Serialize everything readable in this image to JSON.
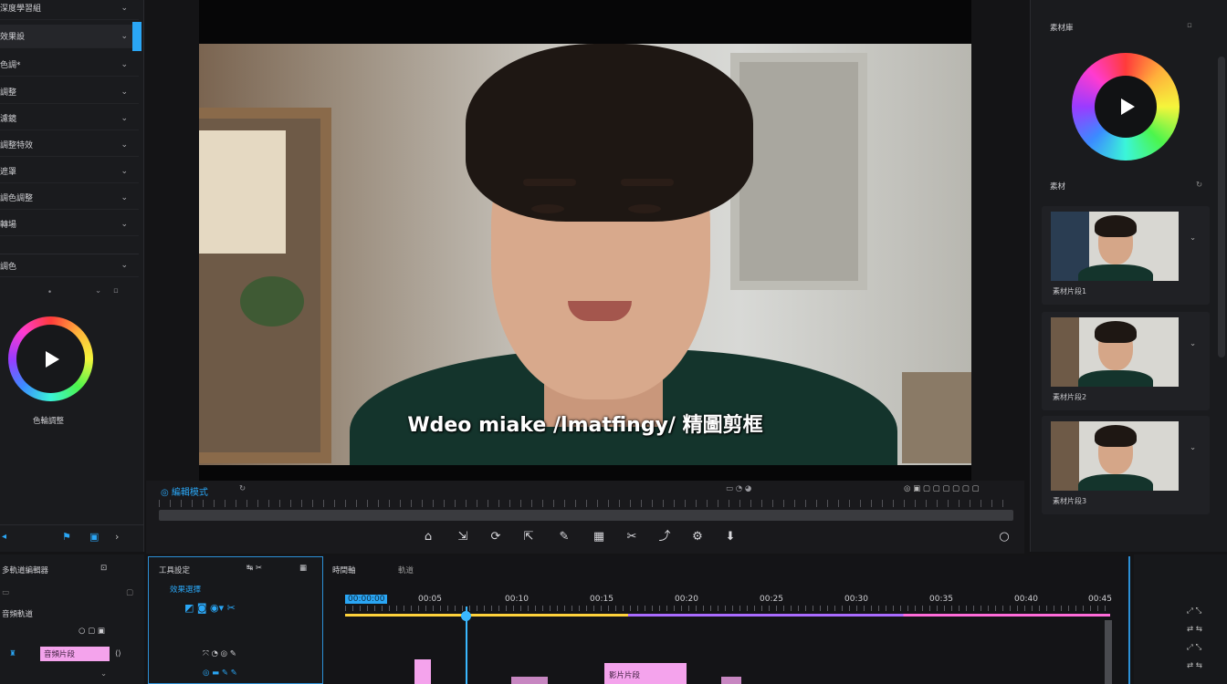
{
  "left_panel": {
    "items": [
      {
        "label": "深度學習組",
        "chevron": "⌄"
      },
      {
        "label": "效果設",
        "chevron": "⌄"
      },
      {
        "label": "色調*",
        "chevron": "⌄"
      },
      {
        "label": "調整",
        "chevron": "⌄"
      },
      {
        "label": "濾鏡",
        "chevron": "⌄"
      },
      {
        "label": "調整特效",
        "chevron": "⌄"
      },
      {
        "label": "遮罩",
        "chevron": "⌄"
      },
      {
        "label": "調色調整",
        "chevron": "⌄"
      },
      {
        "label": "轉場",
        "chevron": "⌄"
      }
    ],
    "section_title": "調色",
    "section_chevron": "⌄",
    "wheel_label": "色輪調整"
  },
  "viewer": {
    "subtitle": "Wdeo miake /lmatfingy/ 精圖剪框"
  },
  "transport": {
    "timecode_label": "◎ 編輯模式",
    "tools": [
      "⌂",
      "⇲",
      "⟳",
      "⇱",
      "✎",
      "▦",
      "✂",
      "⤴",
      "⚙",
      "⬇"
    ],
    "zoom_icon": "○"
  },
  "right_panel": {
    "title": "素材庫",
    "section_label": "素材",
    "thumbs": [
      {
        "label": "素材片段1"
      },
      {
        "label": "素材片段2"
      },
      {
        "label": "素材片段3"
      }
    ]
  },
  "bottom_left": {
    "title": "多軌道編輯器",
    "subtitle": "音頻軌道",
    "clip_label": "音頻片段"
  },
  "tools_box": {
    "title": "工具設定",
    "subtitle": "效果選擇"
  },
  "timeline": {
    "header_a": "時間軸",
    "header_b": "軌道",
    "markers": [
      "00:00:00",
      "00:05",
      "00:10",
      "00:15",
      "00:20",
      "00:25",
      "00:30",
      "00:35",
      "00:40",
      "00:45"
    ],
    "clip_label": "影片片段"
  },
  "colors": {
    "accent": "#2aa6f5",
    "track_yellow": "#ffd23b",
    "track_purple": "#a96bff",
    "track_pink": "#ff6bd8",
    "clip_pink": "#f4a3ec"
  }
}
